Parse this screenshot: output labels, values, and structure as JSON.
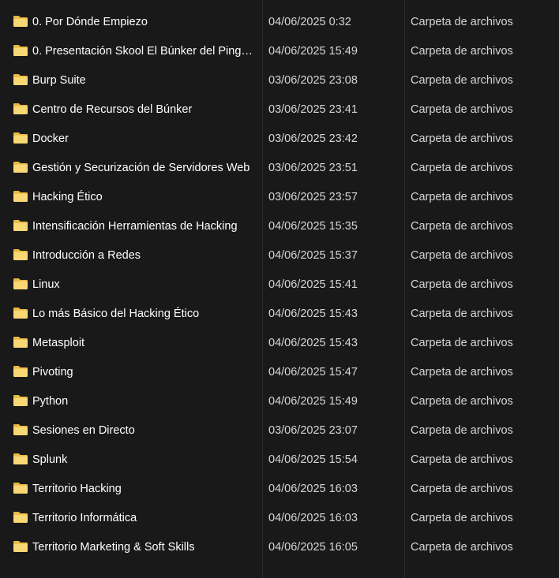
{
  "folder_icon": "folder-icon",
  "colors": {
    "background": "#191919",
    "folder_fill": "#F8D775",
    "folder_tab": "#E8B93F",
    "text_primary": "#FFFFFF",
    "text_secondary": "#D6D6D6"
  },
  "files": [
    {
      "name": "0. Por Dónde Empiezo",
      "date": "04/06/2025 0:32",
      "type": "Carpeta de archivos"
    },
    {
      "name": "0. Presentación Skool El Búnker del Pingu...",
      "date": "04/06/2025 15:49",
      "type": "Carpeta de archivos"
    },
    {
      "name": "Burp Suite",
      "date": "03/06/2025 23:08",
      "type": "Carpeta de archivos"
    },
    {
      "name": "Centro de Recursos del Búnker",
      "date": "03/06/2025 23:41",
      "type": "Carpeta de archivos"
    },
    {
      "name": "Docker",
      "date": "03/06/2025 23:42",
      "type": "Carpeta de archivos"
    },
    {
      "name": "Gestión y Securización de Servidores Web",
      "date": "03/06/2025 23:51",
      "type": "Carpeta de archivos"
    },
    {
      "name": "Hacking Ético",
      "date": "03/06/2025 23:57",
      "type": "Carpeta de archivos"
    },
    {
      "name": "Intensificación Herramientas de Hacking",
      "date": "04/06/2025 15:35",
      "type": "Carpeta de archivos"
    },
    {
      "name": "Introducción a Redes",
      "date": "04/06/2025 15:37",
      "type": "Carpeta de archivos"
    },
    {
      "name": "Linux",
      "date": "04/06/2025 15:41",
      "type": "Carpeta de archivos"
    },
    {
      "name": "Lo más Básico del Hacking Ético",
      "date": "04/06/2025 15:43",
      "type": "Carpeta de archivos"
    },
    {
      "name": "Metasploit",
      "date": "04/06/2025 15:43",
      "type": "Carpeta de archivos"
    },
    {
      "name": "Pivoting",
      "date": "04/06/2025 15:47",
      "type": "Carpeta de archivos"
    },
    {
      "name": "Python",
      "date": "04/06/2025 15:49",
      "type": "Carpeta de archivos"
    },
    {
      "name": "Sesiones en Directo",
      "date": "03/06/2025 23:07",
      "type": "Carpeta de archivos"
    },
    {
      "name": "Splunk",
      "date": "04/06/2025 15:54",
      "type": "Carpeta de archivos"
    },
    {
      "name": "Territorio Hacking",
      "date": "04/06/2025 16:03",
      "type": "Carpeta de archivos"
    },
    {
      "name": "Territorio Informática",
      "date": "04/06/2025 16:03",
      "type": "Carpeta de archivos"
    },
    {
      "name": "Territorio Marketing & Soft Skills",
      "date": "04/06/2025 16:05",
      "type": "Carpeta de archivos"
    }
  ]
}
